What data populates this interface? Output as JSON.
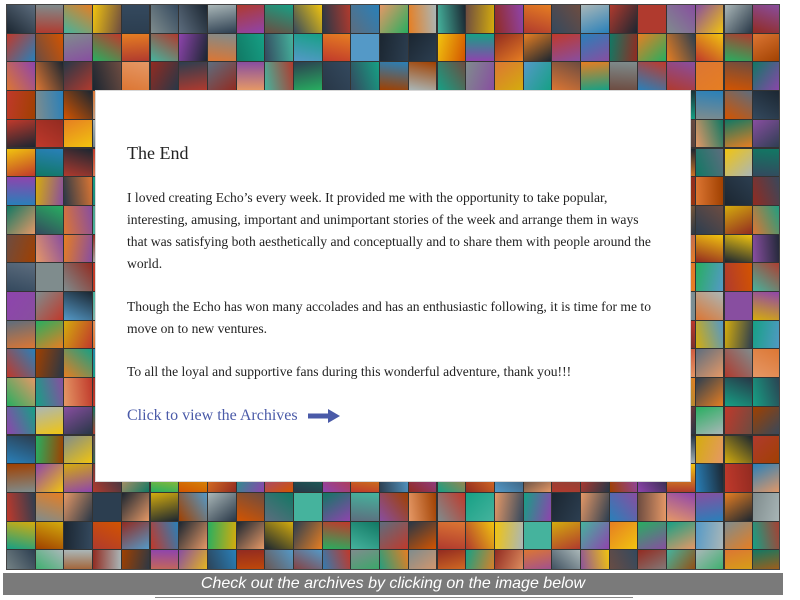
{
  "panel": {
    "title": "The End",
    "paragraphs": [
      "I loved creating Echo’s every week. It provided me with the opportunity to take popular, interesting, amusing, important and unimportant stories of the week and arrange them in ways that was satisfying both aesthetically and conceptually and to share them with people around the world.",
      "Though the Echo has won many accolades and has an enthusiastic following, it is time for me to move on to new ventures.",
      "To all the loyal and supportive fans during this wonderful adventure, thank you!!!"
    ],
    "archives_link": "Click to view the Archives",
    "arrow_icon": "right-arrow-icon"
  },
  "banner": {
    "text": "Check out the archives by clicking on the image below"
  },
  "colors": {
    "link": "#4a5aa8",
    "banner_bg": "#7a7a7a",
    "banner_text": "#ffffff"
  }
}
